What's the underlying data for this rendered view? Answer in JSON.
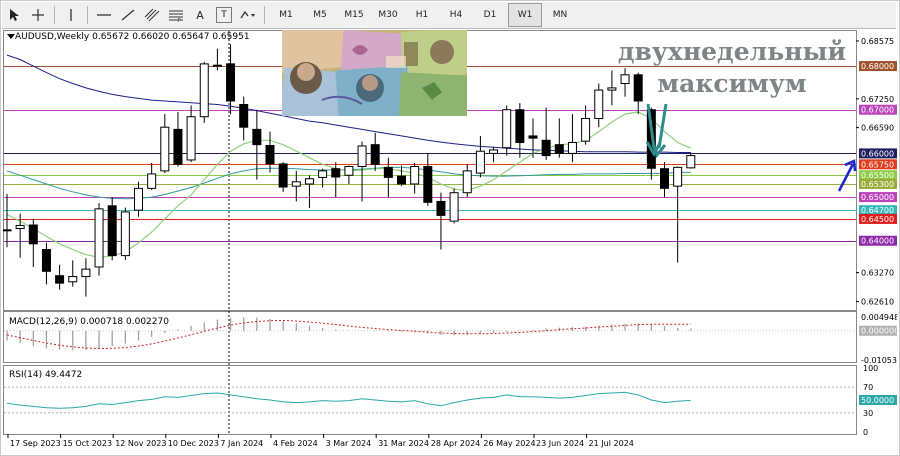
{
  "toolbar": {
    "tools": [
      {
        "name": "cursor-icon"
      },
      {
        "name": "crosshair-icon"
      },
      {
        "name": "vertical-line-icon"
      },
      {
        "name": "horizontal-line-icon"
      },
      {
        "name": "trendline-icon"
      },
      {
        "name": "channel-icon"
      },
      {
        "name": "fibonacci-icon"
      },
      {
        "name": "text-icon",
        "label": "A"
      },
      {
        "name": "text-label-icon",
        "label": "T"
      },
      {
        "name": "shapes-icon"
      }
    ],
    "timeframes": [
      "M1",
      "M5",
      "M15",
      "M30",
      "H1",
      "H4",
      "D1",
      "W1",
      "MN"
    ],
    "active_timeframe": "W1"
  },
  "chart": {
    "title": "AUDUSD,Weekly  0.65672 0.66020 0.65647 0.65951",
    "annotation_lines": [
      "двухнедельный",
      "максимум"
    ],
    "colors": {
      "background": "#ffffff",
      "bull_candle": "#ffffff",
      "bear_candle": "#000000",
      "ma_slow": "#1f1f8f",
      "ma_fast": "#8fd07a",
      "ma_mid": "#2e9a9a",
      "annotation_arrow": "#2e8b8b",
      "blue_arrow": "#1a2acc"
    }
  },
  "chart_data": {
    "type": "candlestick",
    "symbol": "AUDUSD",
    "timeframe": "Weekly",
    "ylim": [
      0.6246,
      0.6878
    ],
    "y_ticks": [
      "0.68575",
      "0.68000",
      "0.67250",
      "0.66590",
      "0.66000",
      "0.65750",
      "0.65500",
      "0.65300",
      "0.65000",
      "0.64700",
      "0.64500",
      "0.64000",
      "0.63270",
      "0.62610"
    ],
    "x_labels": [
      "17 Sep 2023",
      "15 Oct 2023",
      "12 Nov 2023",
      "10 Dec 2023",
      "7 Jan 2024",
      "4 Feb 2024",
      "3 Mar 2024",
      "31 Mar 2024",
      "28 Apr 2024",
      "26 May 2024",
      "23 Jun 2024",
      "21 Jul 2024"
    ],
    "levels": [
      {
        "price": 0.68,
        "label": "0.68000",
        "color": "#a0522d"
      },
      {
        "price": 0.67,
        "label": "0.67000",
        "color": "#bb44bb"
      },
      {
        "price": 0.66,
        "label": "0.66000",
        "color": "#1f1f5f"
      },
      {
        "price": 0.6575,
        "label": "0.65750",
        "color": "#e03c20"
      },
      {
        "price": 0.655,
        "label": "0.65500",
        "color": "#8ccc44"
      },
      {
        "price": 0.653,
        "label": "0.65300",
        "color": "#9aad3a"
      },
      {
        "price": 0.65,
        "label": "0.65000",
        "color": "#bb44bb"
      },
      {
        "price": 0.647,
        "label": "0.64700",
        "color": "#36b8b8"
      },
      {
        "price": 0.645,
        "label": "0.64500",
        "color": "#e01c1c"
      },
      {
        "price": 0.64,
        "label": "0.64000",
        "color": "#8e2aa8"
      }
    ],
    "candles": [
      {
        "o": 0.6425,
        "h": 0.6507,
        "l": 0.6385,
        "c": 0.6425
      },
      {
        "o": 0.6428,
        "h": 0.6462,
        "l": 0.6361,
        "c": 0.6435
      },
      {
        "o": 0.6436,
        "h": 0.645,
        "l": 0.634,
        "c": 0.6393
      },
      {
        "o": 0.638,
        "h": 0.6395,
        "l": 0.63,
        "c": 0.633
      },
      {
        "o": 0.632,
        "h": 0.6345,
        "l": 0.6288,
        "c": 0.6303
      },
      {
        "o": 0.6306,
        "h": 0.6355,
        "l": 0.6295,
        "c": 0.6318
      },
      {
        "o": 0.6318,
        "h": 0.636,
        "l": 0.6272,
        "c": 0.6335
      },
      {
        "o": 0.634,
        "h": 0.6486,
        "l": 0.632,
        "c": 0.6473
      },
      {
        "o": 0.648,
        "h": 0.65,
        "l": 0.6355,
        "c": 0.6366
      },
      {
        "o": 0.6366,
        "h": 0.6476,
        "l": 0.6356,
        "c": 0.6466
      },
      {
        "o": 0.647,
        "h": 0.6535,
        "l": 0.6455,
        "c": 0.652
      },
      {
        "o": 0.652,
        "h": 0.6578,
        "l": 0.6516,
        "c": 0.6553
      },
      {
        "o": 0.656,
        "h": 0.669,
        "l": 0.6555,
        "c": 0.666
      },
      {
        "o": 0.6655,
        "h": 0.6695,
        "l": 0.657,
        "c": 0.6575
      },
      {
        "o": 0.6585,
        "h": 0.671,
        "l": 0.658,
        "c": 0.6684
      },
      {
        "o": 0.6684,
        "h": 0.681,
        "l": 0.667,
        "c": 0.6805
      },
      {
        "o": 0.68,
        "h": 0.684,
        "l": 0.679,
        "c": 0.6802
      },
      {
        "o": 0.6805,
        "h": 0.685,
        "l": 0.669,
        "c": 0.672
      },
      {
        "o": 0.6712,
        "h": 0.673,
        "l": 0.663,
        "c": 0.666
      },
      {
        "o": 0.6655,
        "h": 0.67,
        "l": 0.654,
        "c": 0.662
      },
      {
        "o": 0.6618,
        "h": 0.665,
        "l": 0.6556,
        "c": 0.6576
      },
      {
        "o": 0.6576,
        "h": 0.658,
        "l": 0.6512,
        "c": 0.6523
      },
      {
        "o": 0.6525,
        "h": 0.656,
        "l": 0.649,
        "c": 0.6535
      },
      {
        "o": 0.653,
        "h": 0.655,
        "l": 0.6475,
        "c": 0.6542
      },
      {
        "o": 0.6545,
        "h": 0.6565,
        "l": 0.6522,
        "c": 0.656
      },
      {
        "o": 0.6565,
        "h": 0.658,
        "l": 0.65,
        "c": 0.6546
      },
      {
        "o": 0.655,
        "h": 0.6572,
        "l": 0.653,
        "c": 0.657
      },
      {
        "o": 0.657,
        "h": 0.6627,
        "l": 0.649,
        "c": 0.6617
      },
      {
        "o": 0.662,
        "h": 0.6647,
        "l": 0.656,
        "c": 0.6575
      },
      {
        "o": 0.6568,
        "h": 0.659,
        "l": 0.65,
        "c": 0.6545
      },
      {
        "o": 0.6548,
        "h": 0.6572,
        "l": 0.6525,
        "c": 0.653
      },
      {
        "o": 0.653,
        "h": 0.6578,
        "l": 0.6508,
        "c": 0.657
      },
      {
        "o": 0.657,
        "h": 0.66,
        "l": 0.648,
        "c": 0.6488
      },
      {
        "o": 0.649,
        "h": 0.651,
        "l": 0.638,
        "c": 0.6458
      },
      {
        "o": 0.6445,
        "h": 0.652,
        "l": 0.644,
        "c": 0.651
      },
      {
        "o": 0.651,
        "h": 0.6575,
        "l": 0.65,
        "c": 0.656
      },
      {
        "o": 0.6555,
        "h": 0.664,
        "l": 0.6545,
        "c": 0.6605
      },
      {
        "o": 0.66,
        "h": 0.6615,
        "l": 0.658,
        "c": 0.6608
      },
      {
        "o": 0.6613,
        "h": 0.671,
        "l": 0.6595,
        "c": 0.67
      },
      {
        "o": 0.67,
        "h": 0.6715,
        "l": 0.659,
        "c": 0.6625
      },
      {
        "o": 0.664,
        "h": 0.668,
        "l": 0.659,
        "c": 0.6635
      },
      {
        "o": 0.663,
        "h": 0.6705,
        "l": 0.6585,
        "c": 0.6595
      },
      {
        "o": 0.662,
        "h": 0.668,
        "l": 0.659,
        "c": 0.66
      },
      {
        "o": 0.66,
        "h": 0.669,
        "l": 0.658,
        "c": 0.6625
      },
      {
        "o": 0.6628,
        "h": 0.671,
        "l": 0.662,
        "c": 0.668
      },
      {
        "o": 0.668,
        "h": 0.676,
        "l": 0.666,
        "c": 0.6745
      },
      {
        "o": 0.6745,
        "h": 0.679,
        "l": 0.671,
        "c": 0.675
      },
      {
        "o": 0.676,
        "h": 0.6795,
        "l": 0.673,
        "c": 0.678
      },
      {
        "o": 0.678,
        "h": 0.6785,
        "l": 0.669,
        "c": 0.672
      },
      {
        "o": 0.67,
        "h": 0.6705,
        "l": 0.654,
        "c": 0.6566
      },
      {
        "o": 0.6565,
        "h": 0.658,
        "l": 0.65,
        "c": 0.652
      },
      {
        "o": 0.6525,
        "h": 0.657,
        "l": 0.635,
        "c": 0.6568
      },
      {
        "o": 0.6567,
        "h": 0.6602,
        "l": 0.6565,
        "c": 0.6595
      }
    ],
    "ma_slow": [
      0.6825,
      0.6815,
      0.68,
      0.6785,
      0.6771,
      0.676,
      0.675,
      0.6742,
      0.6735,
      0.673,
      0.6726,
      0.6722,
      0.672,
      0.6718,
      0.6716,
      0.6714,
      0.6712,
      0.6708,
      0.6703,
      0.6698,
      0.6692,
      0.6686,
      0.668,
      0.6674,
      0.667,
      0.6665,
      0.666,
      0.6655,
      0.665,
      0.6645,
      0.664,
      0.6635,
      0.663,
      0.6626,
      0.6622,
      0.6619,
      0.6616,
      0.6614,
      0.6612,
      0.661,
      0.6608,
      0.6607,
      0.6606,
      0.6605,
      0.6604,
      0.6604,
      0.6604,
      0.6604,
      0.6603,
      0.6603,
      0.6603,
      0.6602,
      0.6602
    ],
    "ma_fast": [
      0.646,
      0.6445,
      0.6428,
      0.641,
      0.6393,
      0.638,
      0.6368,
      0.6362,
      0.6365,
      0.6375,
      0.6395,
      0.642,
      0.645,
      0.648,
      0.6505,
      0.654,
      0.6575,
      0.6605,
      0.6622,
      0.663,
      0.663,
      0.662,
      0.6605,
      0.659,
      0.6575,
      0.6565,
      0.656,
      0.6562,
      0.6565,
      0.6565,
      0.656,
      0.6555,
      0.6545,
      0.653,
      0.6518,
      0.6515,
      0.6525,
      0.654,
      0.656,
      0.658,
      0.66,
      0.6612,
      0.662,
      0.6622,
      0.663,
      0.665,
      0.6672,
      0.669,
      0.6695,
      0.668,
      0.665,
      0.6625,
      0.6612
    ],
    "ma_mid": [
      0.656,
      0.655,
      0.654,
      0.653,
      0.652,
      0.6512,
      0.6505,
      0.65,
      0.6497,
      0.6496,
      0.6497,
      0.65,
      0.6506,
      0.6514,
      0.6522,
      0.6532,
      0.6543,
      0.6553,
      0.656,
      0.6565,
      0.6566,
      0.6566,
      0.6565,
      0.6563,
      0.6562,
      0.6562,
      0.6563,
      0.6564,
      0.6566,
      0.6568,
      0.6568,
      0.6566,
      0.6562,
      0.6558,
      0.6553,
      0.655,
      0.6549,
      0.6548,
      0.6548,
      0.6549,
      0.655,
      0.6551,
      0.6552,
      0.6552,
      0.6553,
      0.6553,
      0.6553,
      0.6554,
      0.6554,
      0.6554,
      0.6555,
      0.6556,
      0.6557
    ],
    "macd": {
      "label": "MACD(12,26,9) 0.000718 0.002270",
      "ylim": [
        -0.0112,
        0.006
      ],
      "y_ticks": [
        "0.004948",
        "0.000000",
        "-0.010535"
      ],
      "hist": [
        -0.0035,
        -0.0045,
        -0.0055,
        -0.0063,
        -0.0068,
        -0.007,
        -0.0068,
        -0.0062,
        -0.0055,
        -0.0046,
        -0.0035,
        -0.0022,
        -0.0008,
        0.0005,
        0.0018,
        0.003,
        0.004,
        0.0046,
        0.0048,
        0.0047,
        0.0042,
        0.0035,
        0.0026,
        0.0018,
        0.001,
        0.0004,
        0.0001,
        -0.0001,
        -0.0002,
        -0.0003,
        -0.0004,
        -0.0006,
        -0.001,
        -0.0014,
        -0.0016,
        -0.0015,
        -0.0012,
        -0.0008,
        -0.0004,
        0.0,
        0.0004,
        0.0008,
        0.0011,
        0.0013,
        0.0015,
        0.0018,
        0.0022,
        0.0025,
        0.0026,
        0.0022,
        0.0016,
        0.001,
        0.0007
      ],
      "signal": [
        -0.0015,
        -0.0025,
        -0.0035,
        -0.0044,
        -0.0052,
        -0.0058,
        -0.0062,
        -0.0064,
        -0.0063,
        -0.006,
        -0.0055,
        -0.0047,
        -0.0037,
        -0.0026,
        -0.0014,
        -0.0002,
        0.001,
        0.002,
        0.0028,
        0.0033,
        0.0036,
        0.0037,
        0.0035,
        0.0031,
        0.0027,
        0.0022,
        0.0017,
        0.0012,
        0.0008,
        0.0004,
        0.0001,
        -0.0002,
        -0.0005,
        -0.0008,
        -0.001,
        -0.0011,
        -0.0011,
        -0.001,
        -0.0008,
        -0.0006,
        -0.0003,
        0.0,
        0.0004,
        0.0007,
        0.001,
        0.0013,
        0.0016,
        0.0019,
        0.0022,
        0.0023,
        0.0023,
        0.0023,
        0.0023
      ]
    },
    "rsi": {
      "label": "RSI(14) 49.4472",
      "ylim": [
        0,
        100
      ],
      "y_ticks": [
        "100",
        "70",
        "50.0000",
        "30",
        "0"
      ],
      "values": [
        45,
        42,
        40,
        38,
        37,
        38,
        40,
        44,
        43,
        46,
        49,
        51,
        55,
        54,
        57,
        60,
        61,
        58,
        55,
        52,
        50,
        47,
        46,
        47,
        49,
        48,
        49,
        52,
        50,
        48,
        47,
        49,
        44,
        41,
        46,
        50,
        53,
        54,
        58,
        55,
        55,
        54,
        53,
        54,
        57,
        60,
        61,
        62,
        58,
        50,
        46,
        48,
        49.4
      ]
    }
  }
}
